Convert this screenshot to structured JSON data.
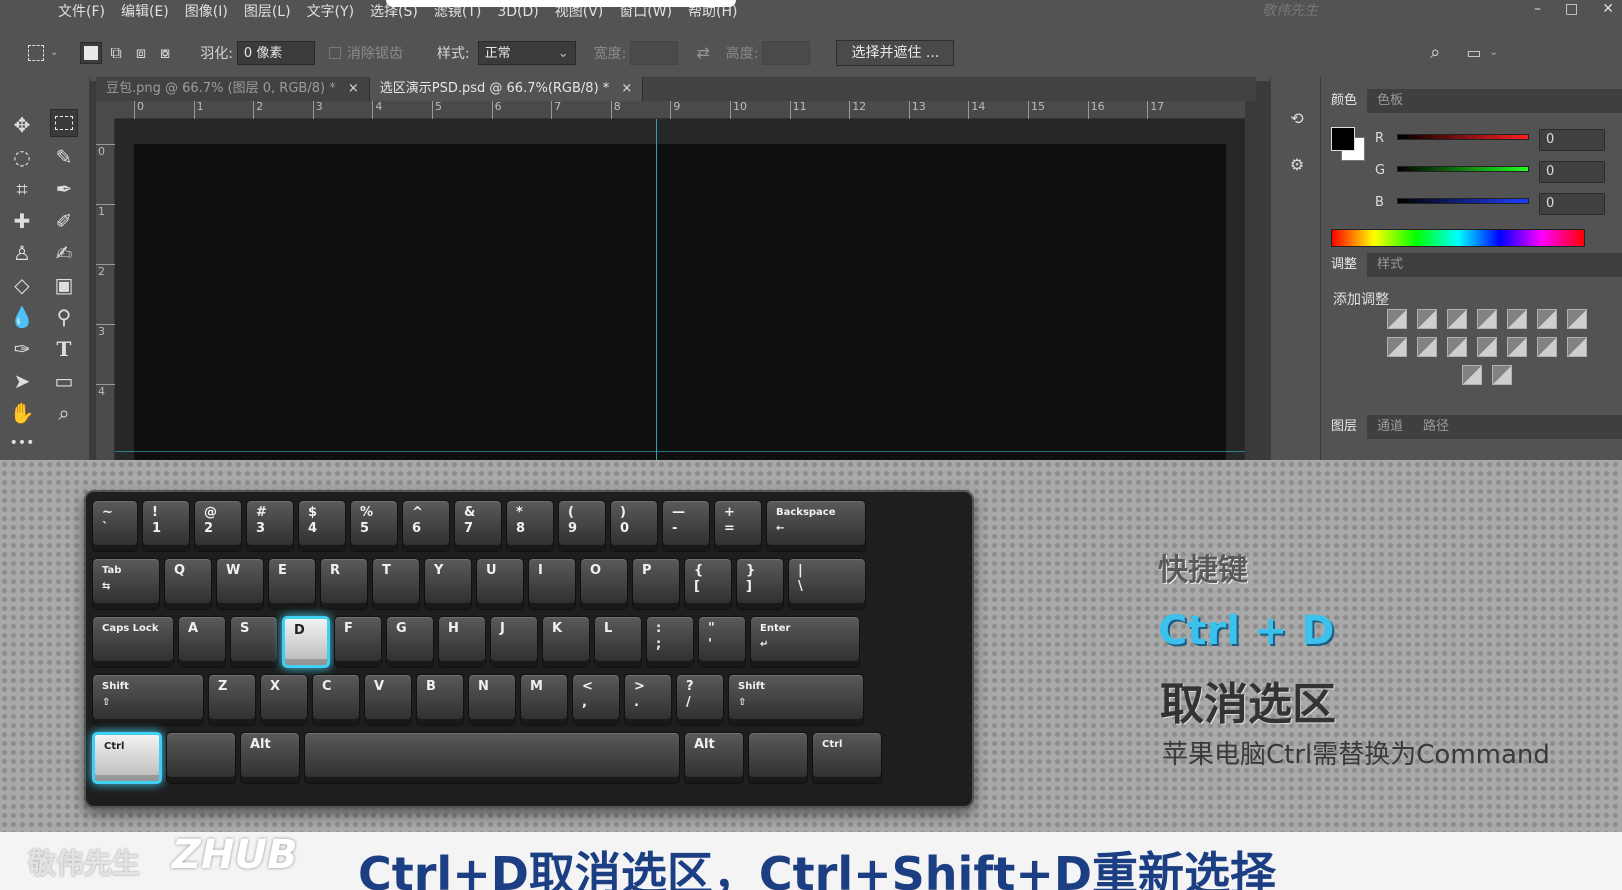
{
  "menubar": {
    "items": [
      "文件(F)",
      "编辑(E)",
      "图像(I)",
      "图层(L)",
      "文字(Y)",
      "选择(S)",
      "滤镜(T)",
      "3D(D)",
      "视图(V)",
      "窗口(W)",
      "帮助(H)"
    ],
    "watermark": "敬伟先生",
    "window_controls": [
      "–",
      "□",
      "✕"
    ]
  },
  "options": {
    "feather_label": "羽化:",
    "feather_value": "0 像素",
    "antialias_label": "消除锯齿",
    "style_label": "样式:",
    "style_value": "正常",
    "width_label": "宽度:",
    "height_label": "高度:",
    "select_mask_button": "选择并遮住 ..."
  },
  "tabs": [
    {
      "label": "豆包.png @ 66.7% (图层 0, RGB/8) *",
      "close": "×"
    },
    {
      "label": "选区演示PSD.psd @ 66.7%(RGB/8) *",
      "close": "×"
    }
  ],
  "rulers": {
    "h": [
      "0",
      "1",
      "2",
      "3",
      "4",
      "5",
      "6",
      "7",
      "8",
      "9",
      "10",
      "11",
      "12",
      "13",
      "14",
      "15",
      "16",
      "17"
    ],
    "v": [
      "0",
      "1",
      "2",
      "3",
      "4"
    ]
  },
  "color_panel": {
    "tabs": [
      "颜色",
      "色板"
    ],
    "r_label": "R",
    "g_label": "G",
    "b_label": "B",
    "r_value": "0",
    "g_value": "0",
    "b_value": "0",
    "foreground": "#000000",
    "background": "#ffffff"
  },
  "adjust_panel": {
    "tabs": [
      "调整",
      "样式"
    ],
    "title": "添加调整"
  },
  "layers_panel": {
    "tabs": [
      "图层",
      "通道",
      "路径"
    ]
  },
  "keyboard": {
    "row1": [
      {
        "label": "~\n`"
      },
      {
        "label": "!\n1"
      },
      {
        "label": "@\n2"
      },
      {
        "label": "#\n3"
      },
      {
        "label": "$\n4"
      },
      {
        "label": "%\n5"
      },
      {
        "label": "^\n6"
      },
      {
        "label": "&\n7"
      },
      {
        "label": "*\n8"
      },
      {
        "label": "(\n9"
      },
      {
        "label": ")\n0"
      },
      {
        "label": "—\n-"
      },
      {
        "label": "+\n="
      },
      {
        "label": "Backspace\n←"
      }
    ],
    "row2": [
      {
        "label": "Tab\n⇆"
      },
      {
        "label": "Q"
      },
      {
        "label": "W"
      },
      {
        "label": "E"
      },
      {
        "label": "R"
      },
      {
        "label": "T"
      },
      {
        "label": "Y"
      },
      {
        "label": "U"
      },
      {
        "label": "I"
      },
      {
        "label": "O"
      },
      {
        "label": "P"
      },
      {
        "label": "{\n["
      },
      {
        "label": "}\n]"
      },
      {
        "label": "|\n\\"
      }
    ],
    "row3": [
      {
        "label": "Caps Lock"
      },
      {
        "label": "A"
      },
      {
        "label": "S"
      },
      {
        "label": "D"
      },
      {
        "label": "F"
      },
      {
        "label": "G"
      },
      {
        "label": "H"
      },
      {
        "label": "J"
      },
      {
        "label": "K"
      },
      {
        "label": "L"
      },
      {
        "label": ":\n;"
      },
      {
        "label": "\"\n'"
      },
      {
        "label": "Enter\n↵"
      }
    ],
    "row4": [
      {
        "label": "Shift\n⇧"
      },
      {
        "label": "Z"
      },
      {
        "label": "X"
      },
      {
        "label": "C"
      },
      {
        "label": "V"
      },
      {
        "label": "B"
      },
      {
        "label": "N"
      },
      {
        "label": "M"
      },
      {
        "label": "<\n,"
      },
      {
        "label": ">\n."
      },
      {
        "label": "?\n/"
      },
      {
        "label": "Shift\n⇧"
      }
    ],
    "row5": [
      {
        "label": "Ctrl"
      },
      {
        "label": ""
      },
      {
        "label": "Alt"
      },
      {
        "label": ""
      },
      {
        "label": "Alt"
      },
      {
        "label": ""
      },
      {
        "label": "Ctrl"
      }
    ],
    "highlighted": [
      "Ctrl",
      "D"
    ],
    "highlight_color": "#3fd0f4"
  },
  "shortcut": {
    "caption": "快捷键",
    "combo": "Ctrl + D",
    "description": "取消选区",
    "note": "苹果电脑Ctrl需替换为Command"
  },
  "footer": {
    "subtitle": "Ctrl+D取消选区，Ctrl+Shift+D重新选择",
    "brand": "敬伟先生",
    "logo": "ZHUB"
  }
}
